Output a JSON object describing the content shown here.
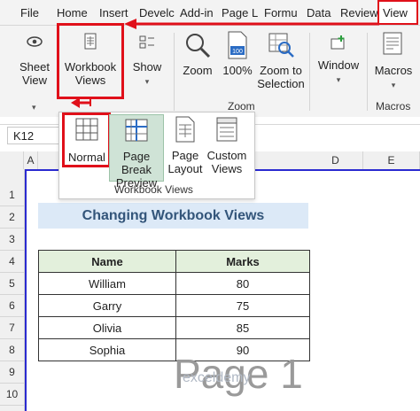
{
  "ribbon_tabs": {
    "file": "File",
    "home": "Home",
    "insert": "Insert",
    "developer": "Develc",
    "addins": "Add-in",
    "page_layout": "Page L",
    "formulas": "Formu",
    "data": "Data",
    "review": "Review",
    "view": "View"
  },
  "ribbon": {
    "sheet_view": [
      "Sheet",
      "View"
    ],
    "workbook_views": [
      "Workbook",
      "Views"
    ],
    "show": "Show",
    "zoom": "Zoom",
    "zoom_100": "100%",
    "zoom_to_selection": [
      "Zoom to",
      "Selection"
    ],
    "window": "Window",
    "macros": "Macros",
    "group_zoom": "Zoom",
    "group_macros": "Macros"
  },
  "namebox": {
    "value": "K12"
  },
  "columns": [
    "A",
    "D",
    "E"
  ],
  "rows": [
    "1",
    "2",
    "3",
    "4",
    "5",
    "6",
    "7",
    "8",
    "9",
    "10"
  ],
  "popup": {
    "normal": "Normal",
    "page_break_preview": [
      "Page Break",
      "Preview"
    ],
    "page_layout": [
      "Page",
      "Layout"
    ],
    "custom_views": [
      "Custom",
      "Views"
    ],
    "group_label": "Workbook Views"
  },
  "sheet": {
    "title": "Changing Workbook Views",
    "headers": [
      "Name",
      "Marks"
    ],
    "rows": [
      [
        "William",
        "80"
      ],
      [
        "Garry",
        "75"
      ],
      [
        "Olivia",
        "85"
      ],
      [
        "Sophia",
        "90"
      ]
    ],
    "watermark": "Page 1"
  },
  "watermark_brand": "exceldemy",
  "colors": {
    "highlight": "#e0101a",
    "title_bg": "#dce9f7",
    "header_bg": "#e3f0dc",
    "page_break": "#2a2ad0"
  }
}
